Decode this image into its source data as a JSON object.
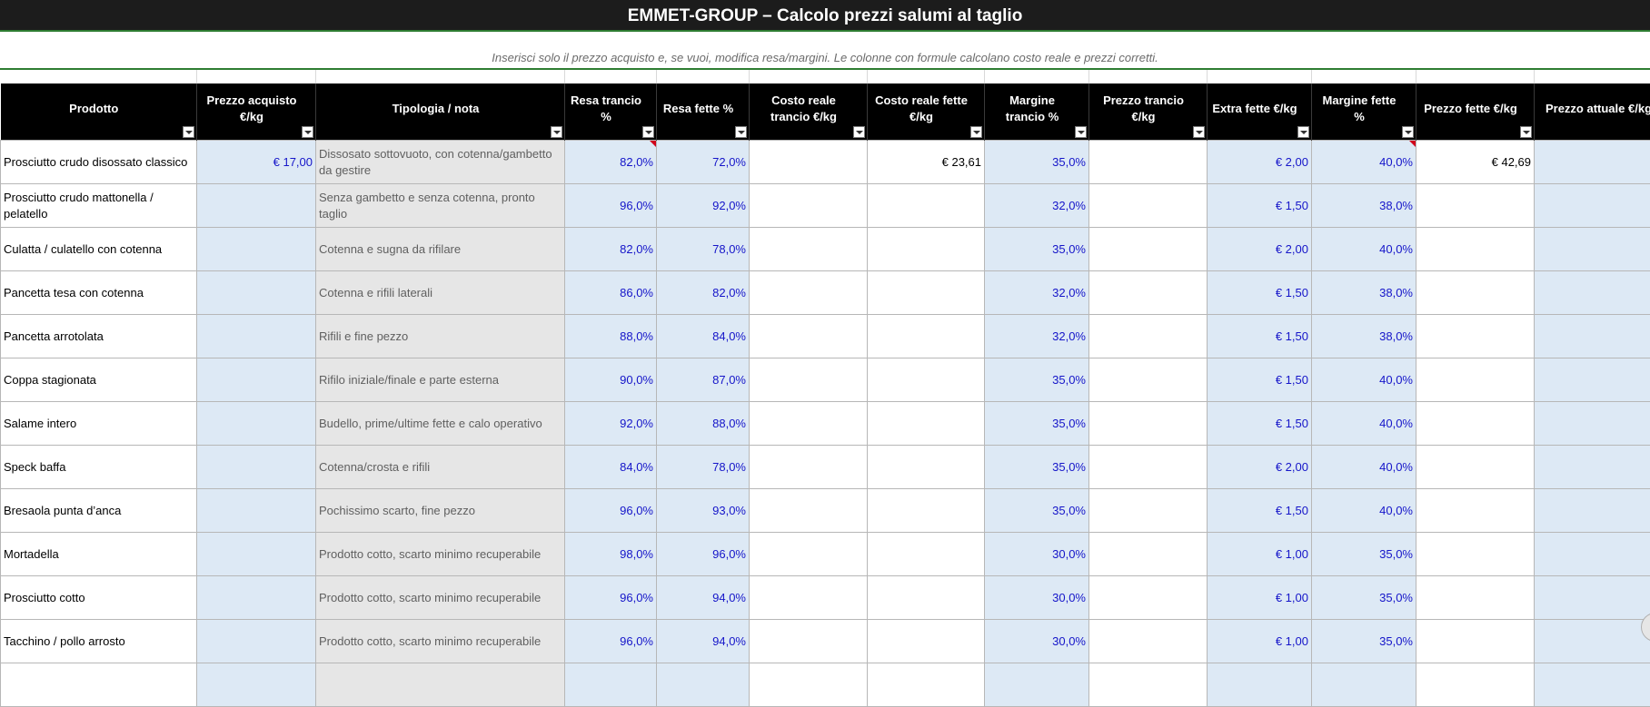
{
  "sheet": {
    "title": "EMMET-GROUP – Calcolo prezzi salumi al taglio",
    "subtitle": "Inserisci solo il prezzo acquisto e, se vuoi, modifica resa/margini. Le colonne con formule calcolano costo reale e prezzi corretti."
  },
  "columns": [
    "Prodotto",
    "Prezzo acquisto €/kg",
    "Tipologia / nota",
    "Resa trancio %",
    "Resa fette %",
    "Costo reale trancio €/kg",
    "Costo reale fette €/kg",
    "Margine trancio %",
    "Prezzo trancio €/kg",
    "Extra fette €/kg",
    "Margine fette %",
    "Prezzo fette €/kg",
    "Prezzo attuale €/kg"
  ],
  "rows": [
    {
      "prodotto": "Prosciutto crudo disossato classico",
      "acquisto": "€ 17,00",
      "nota": "Dissosato sottovuoto, con cotenna/gambetto da gestire",
      "resa_trancio": "82,0%",
      "resa_fette": "72,0%",
      "costo_trancio": "",
      "costo_fette": "€ 23,61",
      "margine_trancio": "35,0%",
      "prezzo_trancio": "",
      "extra_fette": "€ 2,00",
      "margine_fette": "40,0%",
      "prezzo_fette": "€ 42,69",
      "prezzo_attuale": ""
    },
    {
      "prodotto": "Prosciutto crudo mattonella / pelatello",
      "acquisto": "",
      "nota": "Senza gambetto e senza cotenna, pronto taglio",
      "resa_trancio": "96,0%",
      "resa_fette": "92,0%",
      "costo_trancio": "",
      "costo_fette": "",
      "margine_trancio": "32,0%",
      "prezzo_trancio": "",
      "extra_fette": "€ 1,50",
      "margine_fette": "38,0%",
      "prezzo_fette": "",
      "prezzo_attuale": ""
    },
    {
      "prodotto": "Culatta / culatello con cotenna",
      "acquisto": "",
      "nota": "Cotenna e sugna da rifilare",
      "resa_trancio": "82,0%",
      "resa_fette": "78,0%",
      "costo_trancio": "",
      "costo_fette": "",
      "margine_trancio": "35,0%",
      "prezzo_trancio": "",
      "extra_fette": "€ 2,00",
      "margine_fette": "40,0%",
      "prezzo_fette": "",
      "prezzo_attuale": ""
    },
    {
      "prodotto": "Pancetta tesa con cotenna",
      "acquisto": "",
      "nota": "Cotenna e rifili laterali",
      "resa_trancio": "86,0%",
      "resa_fette": "82,0%",
      "costo_trancio": "",
      "costo_fette": "",
      "margine_trancio": "32,0%",
      "prezzo_trancio": "",
      "extra_fette": "€ 1,50",
      "margine_fette": "38,0%",
      "prezzo_fette": "",
      "prezzo_attuale": ""
    },
    {
      "prodotto": "Pancetta arrotolata",
      "acquisto": "",
      "nota": "Rifili e fine pezzo",
      "resa_trancio": "88,0%",
      "resa_fette": "84,0%",
      "costo_trancio": "",
      "costo_fette": "",
      "margine_trancio": "32,0%",
      "prezzo_trancio": "",
      "extra_fette": "€ 1,50",
      "margine_fette": "38,0%",
      "prezzo_fette": "",
      "prezzo_attuale": ""
    },
    {
      "prodotto": "Coppa stagionata",
      "acquisto": "",
      "nota": "Rifilo iniziale/finale e parte esterna",
      "resa_trancio": "90,0%",
      "resa_fette": "87,0%",
      "costo_trancio": "",
      "costo_fette": "",
      "margine_trancio": "35,0%",
      "prezzo_trancio": "",
      "extra_fette": "€ 1,50",
      "margine_fette": "40,0%",
      "prezzo_fette": "",
      "prezzo_attuale": ""
    },
    {
      "prodotto": "Salame intero",
      "acquisto": "",
      "nota": "Budello, prime/ultime fette e calo operativo",
      "resa_trancio": "92,0%",
      "resa_fette": "88,0%",
      "costo_trancio": "",
      "costo_fette": "",
      "margine_trancio": "35,0%",
      "prezzo_trancio": "",
      "extra_fette": "€ 1,50",
      "margine_fette": "40,0%",
      "prezzo_fette": "",
      "prezzo_attuale": ""
    },
    {
      "prodotto": "Speck baffa",
      "acquisto": "",
      "nota": "Cotenna/crosta e rifili",
      "resa_trancio": "84,0%",
      "resa_fette": "78,0%",
      "costo_trancio": "",
      "costo_fette": "",
      "margine_trancio": "35,0%",
      "prezzo_trancio": "",
      "extra_fette": "€ 2,00",
      "margine_fette": "40,0%",
      "prezzo_fette": "",
      "prezzo_attuale": ""
    },
    {
      "prodotto": "Bresaola punta d’anca",
      "acquisto": "",
      "nota": "Pochissimo scarto, fine pezzo",
      "resa_trancio": "96,0%",
      "resa_fette": "93,0%",
      "costo_trancio": "",
      "costo_fette": "",
      "margine_trancio": "35,0%",
      "prezzo_trancio": "",
      "extra_fette": "€ 1,50",
      "margine_fette": "40,0%",
      "prezzo_fette": "",
      "prezzo_attuale": ""
    },
    {
      "prodotto": "Mortadella",
      "acquisto": "",
      "nota": "Prodotto cotto, scarto minimo recuperabile",
      "resa_trancio": "98,0%",
      "resa_fette": "96,0%",
      "costo_trancio": "",
      "costo_fette": "",
      "margine_trancio": "30,0%",
      "prezzo_trancio": "",
      "extra_fette": "€ 1,00",
      "margine_fette": "35,0%",
      "prezzo_fette": "",
      "prezzo_attuale": ""
    },
    {
      "prodotto": "Prosciutto cotto",
      "acquisto": "",
      "nota": "Prodotto cotto, scarto minimo recuperabile",
      "resa_trancio": "96,0%",
      "resa_fette": "94,0%",
      "costo_trancio": "",
      "costo_fette": "",
      "margine_trancio": "30,0%",
      "prezzo_trancio": "",
      "extra_fette": "€ 1,00",
      "margine_fette": "35,0%",
      "prezzo_fette": "",
      "prezzo_attuale": ""
    },
    {
      "prodotto": "Tacchino / pollo arrosto",
      "acquisto": "",
      "nota": "Prodotto cotto, scarto minimo recuperabile",
      "resa_trancio": "96,0%",
      "resa_fette": "94,0%",
      "costo_trancio": "",
      "costo_fette": "",
      "margine_trancio": "30,0%",
      "prezzo_trancio": "",
      "extra_fette": "€ 1,00",
      "margine_fette": "35,0%",
      "prezzo_fette": "",
      "prezzo_attuale": ""
    }
  ]
}
